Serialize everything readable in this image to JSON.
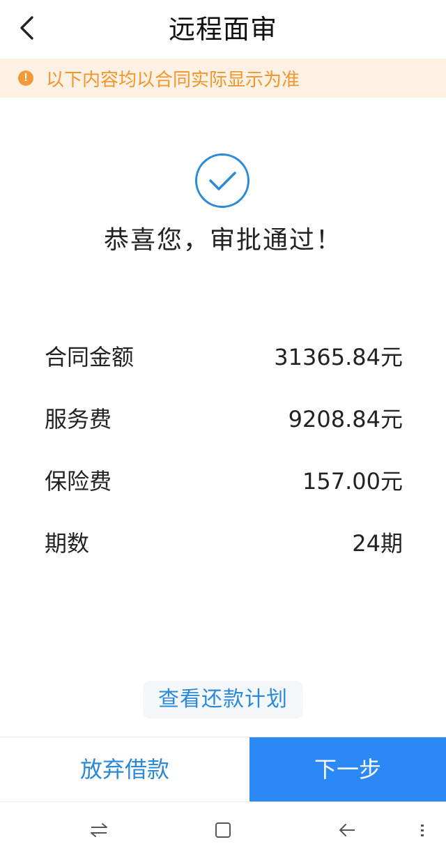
{
  "header": {
    "back_icon": "chevron-left-icon",
    "title": "远程面审"
  },
  "notice": {
    "icon": "exclamation-circle-icon",
    "text": "以下内容均以合同实际显示为准",
    "color": "#f0962f",
    "background": "#fdf1e3"
  },
  "result": {
    "icon": "check-circle-icon",
    "title": "恭喜您，审批通过！",
    "accent": "#2b89d9"
  },
  "details": [
    {
      "label": "合同金额",
      "value": "31365.84元"
    },
    {
      "label": "服务费",
      "value": "9208.84元"
    },
    {
      "label": "保险费",
      "value": "157.00元"
    },
    {
      "label": "期数",
      "value": "24期"
    }
  ],
  "links": {
    "repayment_plan": "查看还款计划"
  },
  "actions": {
    "abandon_label": "放弃借款",
    "next_label": "下一步",
    "primary_color": "#2b89f5"
  },
  "system_nav": {
    "icons": [
      "switch-arrows-icon",
      "home-square-icon",
      "back-arrow-icon",
      "menu-dots-icon"
    ]
  }
}
